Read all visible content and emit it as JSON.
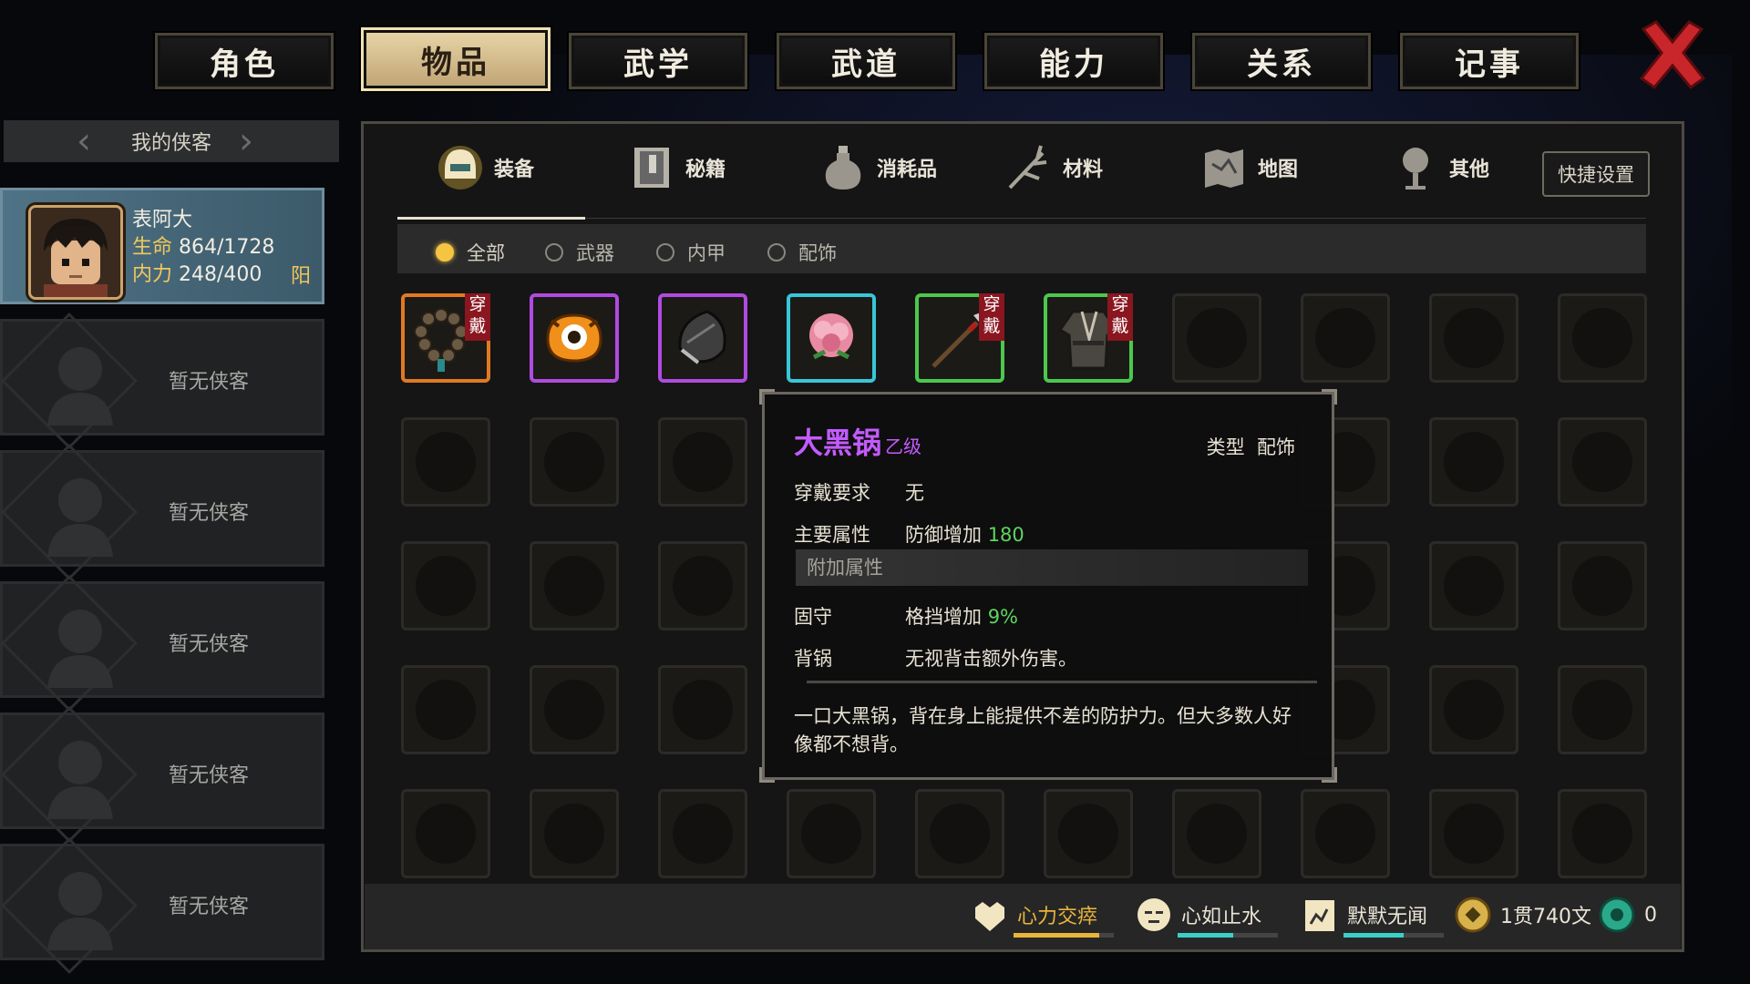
{
  "top_tabs": [
    "角色",
    "物品",
    "武学",
    "武道",
    "能力",
    "关系",
    "记事"
  ],
  "active_top_tab": "物品",
  "sidebar": {
    "header": "我的侠客",
    "character": {
      "name": "表阿大",
      "hp_label": "生命",
      "hp": "864/1728",
      "mp_label": "内力",
      "mp": "248/400",
      "alignment": "阳"
    },
    "empty_label": "暂无侠客"
  },
  "categories": [
    "装备",
    "秘籍",
    "消耗品",
    "材料",
    "地图",
    "其他"
  ],
  "quick_settings": "快捷设置",
  "filters": [
    "全部",
    "武器",
    "内甲",
    "配饰"
  ],
  "worn_label": "穿戴",
  "items": [
    {
      "name": "beads",
      "border": "#e07a22",
      "worn": true
    },
    {
      "name": "eye-monster",
      "border": "#b04be0",
      "worn": false
    },
    {
      "name": "black-wok",
      "border": "#b04be0",
      "worn": false
    },
    {
      "name": "peony",
      "border": "#38c6d8",
      "worn": false
    },
    {
      "name": "spear",
      "border": "#4cc84c",
      "worn": true
    },
    {
      "name": "robe",
      "border": "#4cc84c",
      "worn": true
    }
  ],
  "tooltip": {
    "name": "大黑锅",
    "grade": "乙级",
    "type_label": "类型",
    "type": "配饰",
    "req_label": "穿戴要求",
    "req": "无",
    "main_label": "主要属性",
    "main_text": "防御增加",
    "main_value": "180",
    "extra_header": "附加属性",
    "extra1_label": "固守",
    "extra1_text": "格挡增加",
    "extra1_value": "9%",
    "extra2_label": "背锅",
    "extra2_text": "无视背击额外伤害。",
    "description": "一口大黑锅，背在身上能提供不差的防护力。但大多数人好像都不想背。"
  },
  "status_bar": {
    "stat1": {
      "label": "心力交瘁",
      "level": 0.85,
      "color": "#e8b53a"
    },
    "stat2": {
      "label": "心如止水",
      "level": 0.55,
      "color": "#3ad0c8"
    },
    "stat3": {
      "label": "默默无闻",
      "level": 0.6,
      "color": "#3ad0c8"
    },
    "money": "1贯740文",
    "gems": "0"
  },
  "colors": {
    "accent_gold": "#f4c542",
    "purple_grade": "#c45bff",
    "green_value": "#5fd35f",
    "close_red": "#c8262a"
  }
}
